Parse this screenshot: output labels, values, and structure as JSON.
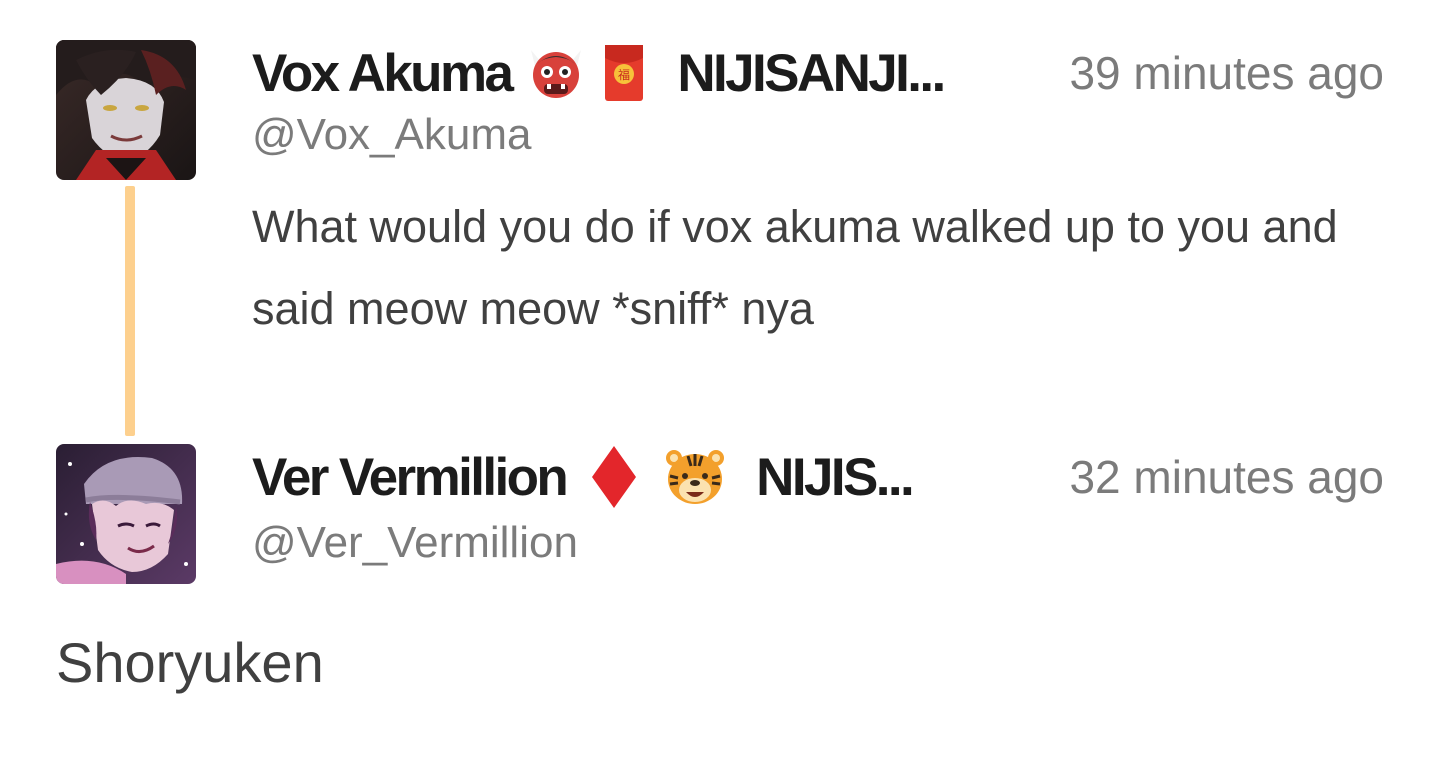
{
  "thread": {
    "parent": {
      "display_name": "Vox Akuma",
      "emojis": [
        "ogre-emoji",
        "red-envelope-emoji"
      ],
      "org": "NIJISANJI...",
      "time": "39 minutes ago",
      "handle": "@Vox_Akuma",
      "text": "What would you do if vox akuma walked up to you and said meow meow *sniff* nya",
      "connector_color": "#fdd08e"
    },
    "reply": {
      "display_name": "Ver Vermillion",
      "emojis": [
        "diamond-suit-emoji",
        "tiger-face-emoji"
      ],
      "org": "NIJIS...",
      "time": "32 minutes ago",
      "handle": "@Ver_Vermillion"
    },
    "comment": {
      "text": "Shoryuken"
    }
  }
}
